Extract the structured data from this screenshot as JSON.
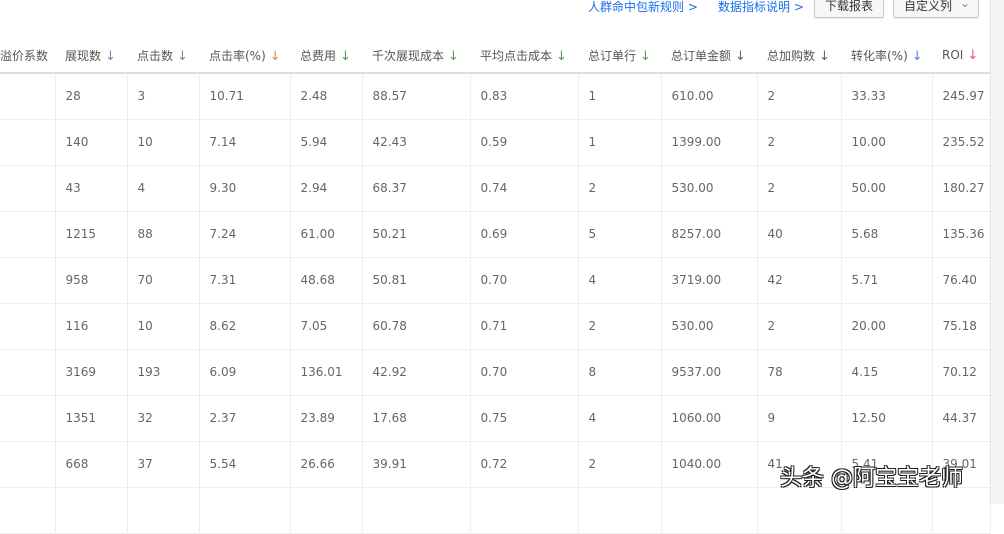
{
  "links": {
    "crowd_rules": "人群命中包新规则 >",
    "metric_help": "数据指标说明 >"
  },
  "buttons": {
    "download": "下载报表",
    "custom_columns": "自定义列",
    "custom_columns_caret": "⌄"
  },
  "columns": [
    {
      "label": "溢价系数",
      "arrow": "",
      "color": "#999"
    },
    {
      "label": "展现数",
      "arrow": "↓",
      "color": "#8a7fa8"
    },
    {
      "label": "点击数",
      "arrow": "↓",
      "color": "#8a7fa8"
    },
    {
      "label": "点击率(%)",
      "arrow": "↓",
      "color": "#e8893a"
    },
    {
      "label": "总费用",
      "arrow": "↓",
      "color": "#5a9a5a"
    },
    {
      "label": "千次展现成本",
      "arrow": "↓",
      "color": "#5a9a5a"
    },
    {
      "label": "平均点击成本",
      "arrow": "↓",
      "color": "#5a9a5a"
    },
    {
      "label": "总订单行",
      "arrow": "↓",
      "color": "#5a9a5a"
    },
    {
      "label": "总订单金额",
      "arrow": "↓",
      "color": "#666"
    },
    {
      "label": "总加购数",
      "arrow": "↓",
      "color": "#666"
    },
    {
      "label": "转化率(%)",
      "arrow": "↓",
      "color": "#5a7fd8"
    },
    {
      "label": "ROI",
      "arrow": "↓",
      "color": "#e8508a"
    }
  ],
  "rows": [
    [
      "",
      "28",
      "3",
      "10.71",
      "2.48",
      "88.57",
      "0.83",
      "1",
      "610.00",
      "2",
      "33.33",
      "245.97"
    ],
    [
      "",
      "140",
      "10",
      "7.14",
      "5.94",
      "42.43",
      "0.59",
      "1",
      "1399.00",
      "2",
      "10.00",
      "235.52"
    ],
    [
      "",
      "43",
      "4",
      "9.30",
      "2.94",
      "68.37",
      "0.74",
      "2",
      "530.00",
      "2",
      "50.00",
      "180.27"
    ],
    [
      "",
      "1215",
      "88",
      "7.24",
      "61.00",
      "50.21",
      "0.69",
      "5",
      "8257.00",
      "40",
      "5.68",
      "135.36"
    ],
    [
      "",
      "958",
      "70",
      "7.31",
      "48.68",
      "50.81",
      "0.70",
      "4",
      "3719.00",
      "42",
      "5.71",
      "76.40"
    ],
    [
      "",
      "116",
      "10",
      "8.62",
      "7.05",
      "60.78",
      "0.71",
      "2",
      "530.00",
      "2",
      "20.00",
      "75.18"
    ],
    [
      "",
      "3169",
      "193",
      "6.09",
      "136.01",
      "42.92",
      "0.70",
      "8",
      "9537.00",
      "78",
      "4.15",
      "70.12"
    ],
    [
      "",
      "1351",
      "32",
      "2.37",
      "23.89",
      "17.68",
      "0.75",
      "4",
      "1060.00",
      "9",
      "12.50",
      "44.37"
    ],
    [
      "",
      "668",
      "37",
      "5.54",
      "26.66",
      "39.91",
      "0.72",
      "2",
      "1040.00",
      "41",
      "5.41",
      "39.01"
    ],
    [
      "",
      "",
      "",
      "",
      "",
      "",
      "",
      "",
      "",
      "",
      "",
      ""
    ]
  ],
  "watermark": "头条 @阿宝宝老师"
}
